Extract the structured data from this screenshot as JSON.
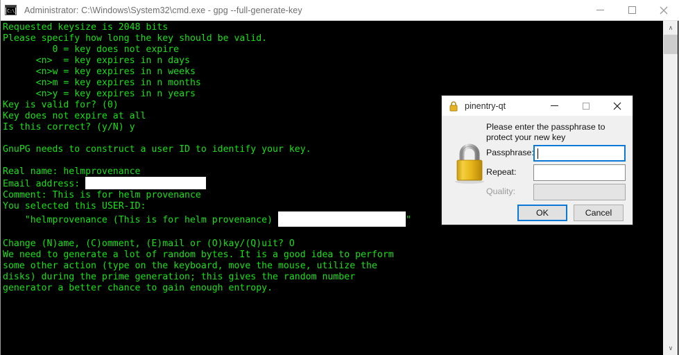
{
  "console_window": {
    "icon": "cmd-icon",
    "icon_glyph": "C:\\",
    "title": "Administrator: C:\\Windows\\System32\\cmd.exe - gpg  --full-generate-key",
    "controls": {
      "minimize": "minimize-icon",
      "maximize": "maximize-icon",
      "close": "close-icon"
    },
    "scrollbar": {
      "up_arrow": "∧",
      "down_arrow": "∨"
    },
    "terminal": {
      "foreground_color": "#19e019",
      "background_color": "#000000",
      "lines_before_email": "Requested keysize is 2048 bits\nPlease specify how long the key should be valid.\n         0 = key does not expire\n      <n>  = key expires in n days\n      <n>w = key expires in n weeks\n      <n>m = key expires in n months\n      <n>y = key expires in n years\nKey is valid for? (0)\nKey does not expire at all\nIs this correct? (y/N) y\n\nGnuPG needs to construct a user ID to identify your key.\n\nReal name: helmprovenance\nEmail address: ",
      "lines_after_email": "\nComment: This is for helm provenance\nYou selected this USER-ID:\n    \"helmprovenance (This is for helm provenance) ",
      "lines_after_userid": "\"\n\nChange (N)ame, (C)omment, (E)mail or (O)kay/(Q)uit? O\nWe need to generate a lot of random bytes. It is a good idea to perform\nsome other action (type on the keyboard, move the mouse, utilize the\ndisks) during the prime generation; this gives the random number\ngenerator a better chance to gain enough entropy.",
      "redactions": [
        {
          "name": "email-address-redaction",
          "color": "#ffffff"
        },
        {
          "name": "user-id-redaction",
          "color": "#ffffff"
        }
      ]
    }
  },
  "pinentry_dialog": {
    "title": "pinentry-qt",
    "icon": "lock-icon",
    "controls": {
      "minimize": "minimize-icon",
      "maximize": "maximize-icon",
      "close": "close-icon"
    },
    "prompt": "Please enter the passphrase to protect your new key",
    "fields": [
      {
        "label": "Passphrase:",
        "value": "",
        "focused": true,
        "disabled": false
      },
      {
        "label": "Repeat:",
        "value": "",
        "focused": false,
        "disabled": false
      },
      {
        "label": "Quality:",
        "value": "",
        "focused": false,
        "disabled": true
      }
    ],
    "buttons": {
      "ok": "OK",
      "cancel": "Cancel"
    },
    "accent_color": "#0a78d7"
  }
}
